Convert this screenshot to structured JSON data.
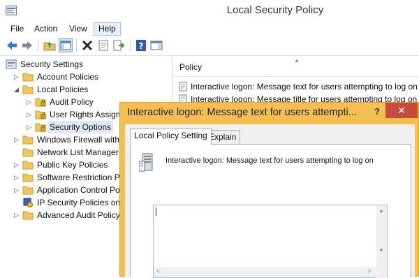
{
  "window": {
    "title": "Local Security Policy"
  },
  "menu": {
    "file": "File",
    "action": "Action",
    "view": "View",
    "help": "Help"
  },
  "toolbar": [
    {
      "icon": "back-arrow-icon"
    },
    {
      "icon": "forward-arrow-icon"
    },
    {
      "icon": "up-folder-icon"
    },
    {
      "icon": "show-hide-tree-icon"
    },
    {
      "icon": "delete-icon"
    },
    {
      "icon": "properties-icon"
    },
    {
      "icon": "export-list-icon"
    },
    {
      "icon": "help-icon"
    },
    {
      "icon": "show-hide-action-pane-icon"
    }
  ],
  "tree": {
    "root": "Security Settings",
    "items": [
      {
        "label": "Account Policies",
        "expand": "collapsed"
      },
      {
        "label": "Local Policies",
        "expand": "expanded"
      },
      {
        "label": "Audit Policy",
        "expand": "collapsed"
      },
      {
        "label": "User Rights Assignm",
        "expand": "collapsed"
      },
      {
        "label": "Security Options",
        "expand": "collapsed",
        "selected": true
      },
      {
        "label": "Windows Firewall with A",
        "expand": "collapsed"
      },
      {
        "label": "Network List Manager P",
        "expand": "none"
      },
      {
        "label": "Public Key Policies",
        "expand": "collapsed"
      },
      {
        "label": "Software Restriction Po",
        "expand": "collapsed"
      },
      {
        "label": "Application Control Pol",
        "expand": "collapsed"
      },
      {
        "label": "IP Security Policies on L",
        "expand": "none"
      },
      {
        "label": "Advanced Audit Policy",
        "expand": "collapsed"
      }
    ]
  },
  "list": {
    "column_header": "Policy",
    "rows": [
      "Interactive logon: Message text for users attempting to log on",
      "Interactive logon: Message title for users attempting to log on"
    ]
  },
  "dialog": {
    "title": "Interactive logon: Message text for users attempti...",
    "help": "?",
    "close": "✕",
    "tabs": {
      "local": "Local Policy Setting",
      "explain": "Explain"
    },
    "policy_name": "Interactive logon: Message text for users attempting to log on",
    "message_value": ""
  },
  "colors": {
    "dialog_frame": "#f4bf4e",
    "close_button": "#c74b39",
    "selection": "#dfe9f4",
    "accent": "#1e6fc0"
  }
}
